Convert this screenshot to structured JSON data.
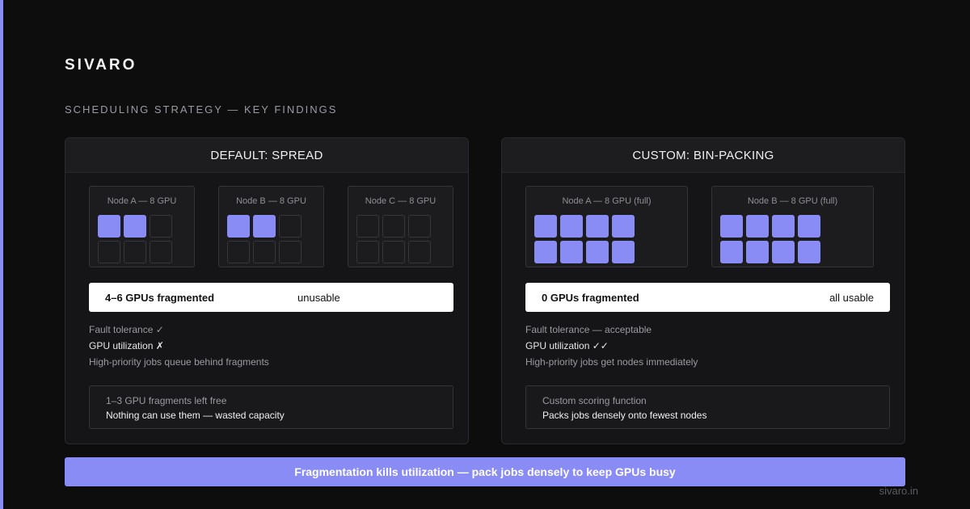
{
  "colors": {
    "accent": "#8a8cf5",
    "background": "#0d0d0e",
    "panel": "#151517"
  },
  "brand": "SIVARO",
  "subtitle": "SCHEDULING STRATEGY — KEY FINDINGS",
  "left_panel": {
    "title": "DEFAULT: SPREAD",
    "nodes": [
      {
        "label": "Node A — 8 GPU",
        "used": 2,
        "total": 6
      },
      {
        "label": "Node B — 8 GPU",
        "used": 2,
        "total": 6
      },
      {
        "label": "Node C — 8 GPU",
        "used": 0,
        "total": 6
      }
    ],
    "result": {
      "main": "4–6 GPUs fragmented",
      "note": "unusable"
    },
    "facts": [
      "Fault tolerance ✓",
      "GPU utilization ✗",
      "High-priority jobs queue behind fragments"
    ],
    "note": {
      "title": "1–3 GPU fragments left free",
      "body": "Nothing can use them — wasted capacity"
    }
  },
  "right_panel": {
    "title": "CUSTOM: BIN-PACKING",
    "nodes": [
      {
        "label": "Node A — 8 GPU (full)",
        "used": 8,
        "total": 8
      },
      {
        "label": "Node B — 8 GPU (full)",
        "used": 8,
        "total": 8
      }
    ],
    "result": {
      "main": "0 GPUs fragmented",
      "note": "all usable"
    },
    "facts": [
      "Fault tolerance — acceptable",
      "GPU utilization ✓✓",
      "High-priority jobs get nodes immediately"
    ],
    "note": {
      "title": "Custom scoring function",
      "body": "Packs jobs densely onto fewest nodes"
    }
  },
  "banner": "Fragmentation kills utilization — pack jobs densely to keep GPUs busy",
  "site": "sivaro.in"
}
